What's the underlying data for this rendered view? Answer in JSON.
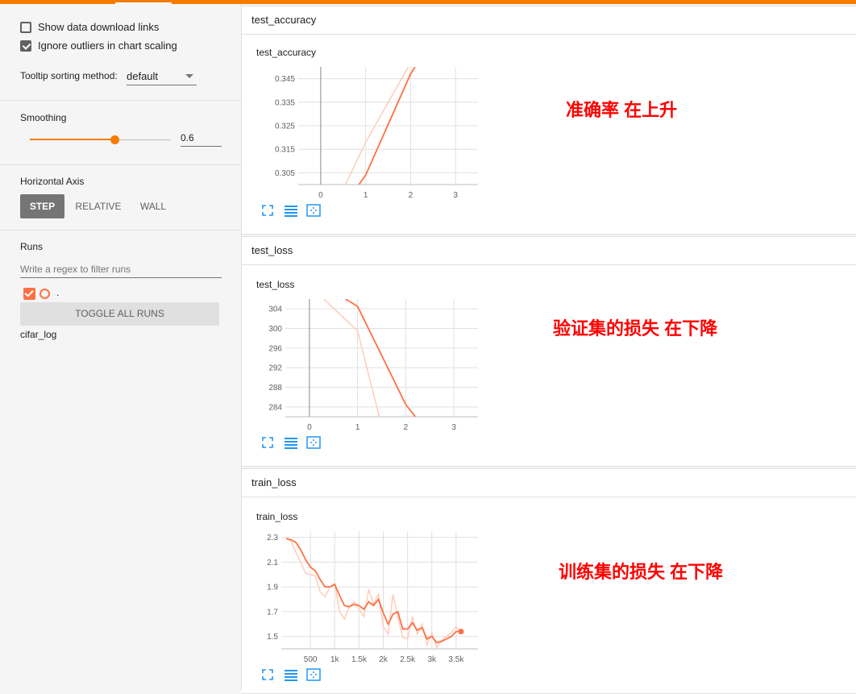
{
  "sidebar": {
    "show_download": "Show data download links",
    "ignore_outliers": "Ignore outliers in chart scaling",
    "tooltip_label": "Tooltip sorting method:",
    "tooltip_value": "default",
    "smoothing_label": "Smoothing",
    "smoothing_value": "0.6",
    "smoothing_fraction": 0.6,
    "horizontal_axis_label": "Horizontal Axis",
    "axis_options": [
      "STEP",
      "RELATIVE",
      "WALL"
    ],
    "runs_label": "Runs",
    "filter_placeholder": "Write a regex to filter runs",
    "run_name": ".",
    "toggle_all": "TOGGLE ALL RUNS",
    "log_name": "cifar_log"
  },
  "groups": [
    {
      "name": "test_accuracy",
      "chart_title": "test_accuracy",
      "annotation": "准确率  在上升"
    },
    {
      "name": "test_loss",
      "chart_title": "test_loss",
      "annotation": "验证集的损失 在下降"
    },
    {
      "name": "train_loss",
      "chart_title": "train_loss",
      "annotation": "训练集的损失 在下降"
    }
  ],
  "colors": {
    "accent": "#f57c00",
    "series": "#ff7043",
    "series_raw": "#ffccbc",
    "annotation": "#ff0000"
  },
  "chart_data": [
    {
      "type": "line",
      "title": "test_accuracy",
      "x_ticks": [
        0,
        1,
        2,
        3
      ],
      "y_ticks": [
        0.305,
        0.315,
        0.325,
        0.335,
        0.345
      ],
      "xlim": [
        -0.5,
        3.5
      ],
      "ylim": [
        0.3,
        0.35
      ],
      "series": [
        {
          "kind": "smoothed",
          "x": [
            0.85,
            1.0,
            2.0,
            2.1
          ],
          "y": [
            0.3,
            0.304,
            0.347,
            0.35
          ]
        },
        {
          "kind": "raw",
          "x": [
            0.55,
            1.0,
            1.95
          ],
          "y": [
            0.3,
            0.318,
            0.35
          ]
        }
      ]
    },
    {
      "type": "line",
      "title": "test_loss",
      "x_ticks": [
        0,
        1,
        2,
        3
      ],
      "y_ticks": [
        284,
        288,
        292,
        296,
        300,
        304
      ],
      "xlim": [
        -0.5,
        3.5
      ],
      "ylim": [
        282,
        306
      ],
      "series": [
        {
          "kind": "smoothed",
          "x": [
            0.75,
            1.0,
            2.0,
            2.2
          ],
          "y": [
            306,
            304.5,
            284.5,
            282
          ]
        },
        {
          "kind": "raw",
          "x": [
            0.3,
            1.0,
            1.45
          ],
          "y": [
            306,
            299.5,
            282
          ]
        }
      ]
    },
    {
      "type": "line",
      "title": "train_loss",
      "x_ticks": [
        500,
        1000,
        1500,
        2000,
        2500,
        3000,
        3500
      ],
      "x_tick_labels": [
        "500",
        "1k",
        "1.5k",
        "2k",
        "2.5k",
        "3k",
        "3.5k"
      ],
      "y_ticks": [
        1.5,
        1.7,
        1.9,
        2.1,
        2.3
      ],
      "xlim": [
        -100,
        3950
      ],
      "ylim": [
        1.4,
        2.35
      ],
      "series": [
        {
          "kind": "smoothed",
          "x": [
            0,
            100,
            200,
            300,
            400,
            500,
            600,
            700,
            800,
            900,
            1000,
            1100,
            1200,
            1300,
            1400,
            1500,
            1600,
            1700,
            1800,
            1900,
            2000,
            2100,
            2200,
            2300,
            2400,
            2500,
            2600,
            2700,
            2800,
            2900,
            3000,
            3100,
            3200,
            3300,
            3400,
            3500,
            3600
          ],
          "y": [
            2.29,
            2.28,
            2.26,
            2.2,
            2.12,
            2.06,
            2.03,
            1.96,
            1.9,
            1.9,
            1.92,
            1.83,
            1.75,
            1.74,
            1.76,
            1.75,
            1.72,
            1.78,
            1.75,
            1.8,
            1.69,
            1.6,
            1.68,
            1.7,
            1.56,
            1.56,
            1.61,
            1.55,
            1.57,
            1.48,
            1.5,
            1.45,
            1.46,
            1.48,
            1.5,
            1.54,
            1.54
          ]
        },
        {
          "kind": "raw",
          "x": [
            0,
            100,
            200,
            300,
            400,
            500,
            600,
            700,
            800,
            900,
            1000,
            1100,
            1200,
            1300,
            1400,
            1500,
            1600,
            1700,
            1800,
            1900,
            2000,
            2100,
            2200,
            2300,
            2400,
            2500,
            2600,
            2700,
            2800,
            2900,
            3000,
            3100,
            3200,
            3300,
            3400,
            3500,
            3600
          ],
          "y": [
            2.3,
            2.27,
            2.18,
            2.1,
            2.01,
            2.0,
            1.99,
            1.86,
            1.82,
            1.9,
            1.93,
            1.7,
            1.64,
            1.74,
            1.78,
            1.72,
            1.66,
            1.88,
            1.76,
            1.84,
            1.58,
            1.52,
            1.84,
            1.66,
            1.49,
            1.48,
            1.66,
            1.52,
            1.6,
            1.43,
            1.53,
            1.41,
            1.47,
            1.5,
            1.53,
            1.58,
            1.54
          ]
        }
      ]
    }
  ]
}
